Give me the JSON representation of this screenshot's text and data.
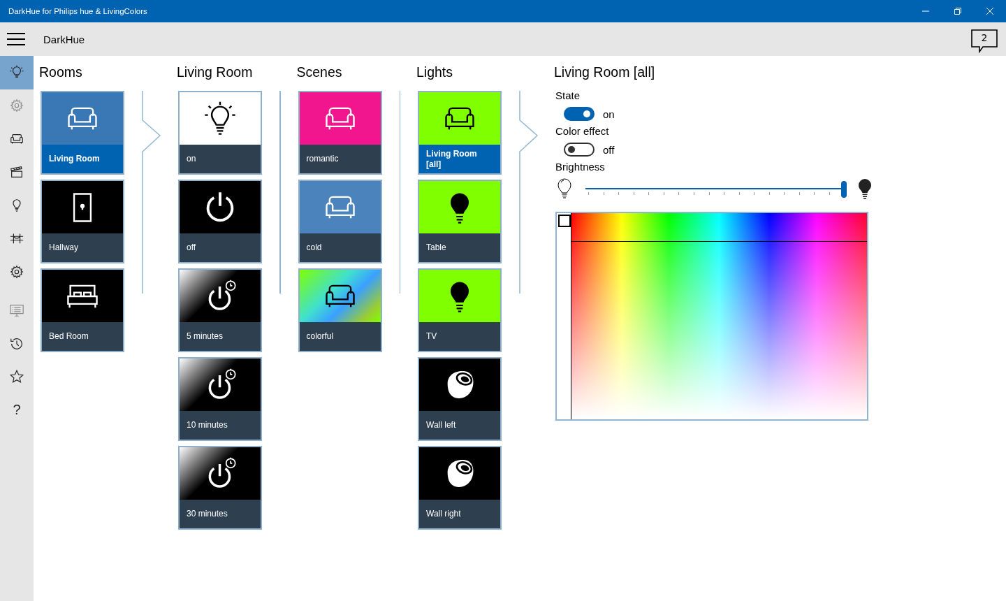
{
  "window": {
    "title": "DarkHue for Philips hue & LivingColors"
  },
  "header": {
    "title": "DarkHue",
    "notifications": "2"
  },
  "sidebar": {
    "items": [
      {
        "kind": "bulb-rays",
        "selected": true,
        "disabled": false
      },
      {
        "kind": "gear",
        "selected": false,
        "disabled": true
      },
      {
        "kind": "sofa",
        "selected": false,
        "disabled": false
      },
      {
        "kind": "clapperboard",
        "selected": false,
        "disabled": false
      },
      {
        "kind": "bulb",
        "selected": false,
        "disabled": false
      },
      {
        "kind": "bridge",
        "selected": false,
        "disabled": false
      },
      {
        "kind": "gear",
        "selected": false,
        "disabled": false
      },
      {
        "kind": "monitor",
        "selected": false,
        "disabled": true
      },
      {
        "kind": "history",
        "selected": false,
        "disabled": false
      },
      {
        "kind": "star",
        "selected": false,
        "disabled": false
      },
      {
        "kind": "glyph",
        "glyph": "?",
        "selected": false,
        "disabled": false
      }
    ]
  },
  "columns": [
    {
      "title": "Rooms",
      "leads_to_next": true,
      "tiles": [
        {
          "label": "Living Room",
          "selected": true,
          "kind": "sofa",
          "color": "#3a78b5"
        },
        {
          "label": "Hallway",
          "selected": false,
          "kind": "door",
          "color": "#000000"
        },
        {
          "label": "Bed Room",
          "selected": false,
          "kind": "bed",
          "color": "#000000"
        }
      ]
    },
    {
      "title": "Living Room",
      "leads_to_next": false,
      "tiles": [
        {
          "label": "on",
          "selected": false,
          "kind": "bulb-rays",
          "color": "#ffffff"
        },
        {
          "label": "off",
          "selected": false,
          "kind": "power",
          "color": "#000000"
        },
        {
          "label": "5 minutes",
          "selected": false,
          "kind": "timer"
        },
        {
          "label": "10 minutes",
          "selected": false,
          "kind": "timer"
        },
        {
          "label": "30 minutes",
          "selected": false,
          "kind": "timer"
        }
      ]
    },
    {
      "title": "Scenes",
      "leads_to_next": false,
      "tiles": [
        {
          "label": "romantic",
          "selected": false,
          "kind": "sofa",
          "color": "#f2168e"
        },
        {
          "label": "cold",
          "selected": false,
          "kind": "sofa",
          "color": "#4b84bd"
        },
        {
          "label": "colorful",
          "selected": false,
          "kind": "sofa-colorful"
        }
      ]
    },
    {
      "title": "Lights",
      "leads_to_next": true,
      "tiles": [
        {
          "label": "Living Room [all]",
          "selected": true,
          "kind": "sofa",
          "color": "#80ff00"
        },
        {
          "label": "Table",
          "selected": false,
          "kind": "bulb-filled",
          "color": "#80ff00"
        },
        {
          "label": "TV",
          "selected": false,
          "kind": "bulb-filled",
          "color": "#80ff00"
        },
        {
          "label": "Wall left",
          "selected": false,
          "kind": "lamp",
          "color": "#000000"
        },
        {
          "label": "Wall right",
          "selected": false,
          "kind": "lamp",
          "color": "#000000"
        }
      ]
    }
  ],
  "details": {
    "title": "Living Room [all]",
    "state": {
      "label": "State",
      "on": true,
      "text": "on"
    },
    "color_effect": {
      "label": "Color effect",
      "on": false,
      "text": "off"
    },
    "brightness": {
      "label": "Brightness",
      "level": 1.0
    }
  }
}
